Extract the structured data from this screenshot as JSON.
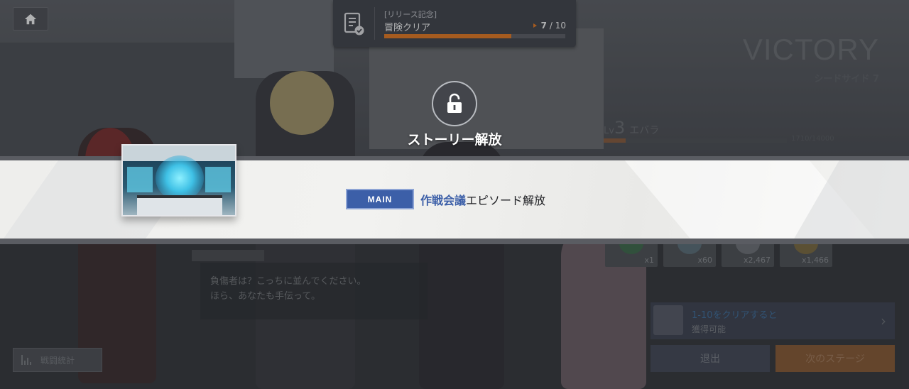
{
  "mission": {
    "tag": "[リリース記念]",
    "name": "冒険クリア",
    "current": "7",
    "total": "/ 10",
    "progress": 0.7,
    "accent": "#ef7b1e"
  },
  "result": {
    "title": "VICTORY",
    "stage": "シードサイド 7",
    "lv_prefix": "Lv",
    "level": "3",
    "player_name": "エバラ",
    "exp_text": "1710/14000",
    "exp_progress": 0.12
  },
  "rewards": [
    {
      "qty": "x1",
      "icon": "item-green-icon"
    },
    {
      "qty": "x60",
      "icon": "item-crystal-icon"
    },
    {
      "qty": "x2,467",
      "icon": "item-silver-icon"
    },
    {
      "qty": "x1,466",
      "icon": "item-gold-icon"
    }
  ],
  "dialogue": {
    "text": "負傷者は？こっちに並んでください。\nほら、あなたも手伝って。"
  },
  "stats_button": "戦闘統計",
  "clear_reward": {
    "line1": "1-10をクリアすると",
    "line2": "獲得可能"
  },
  "buttons": {
    "exit": "退出",
    "next": "次のステージ"
  },
  "unlock": {
    "title": "ストーリー解放",
    "badge": "MAIN",
    "episode_name": "作戦会議",
    "message": "エピソード解放",
    "badge_color": "#3c5fa8"
  }
}
